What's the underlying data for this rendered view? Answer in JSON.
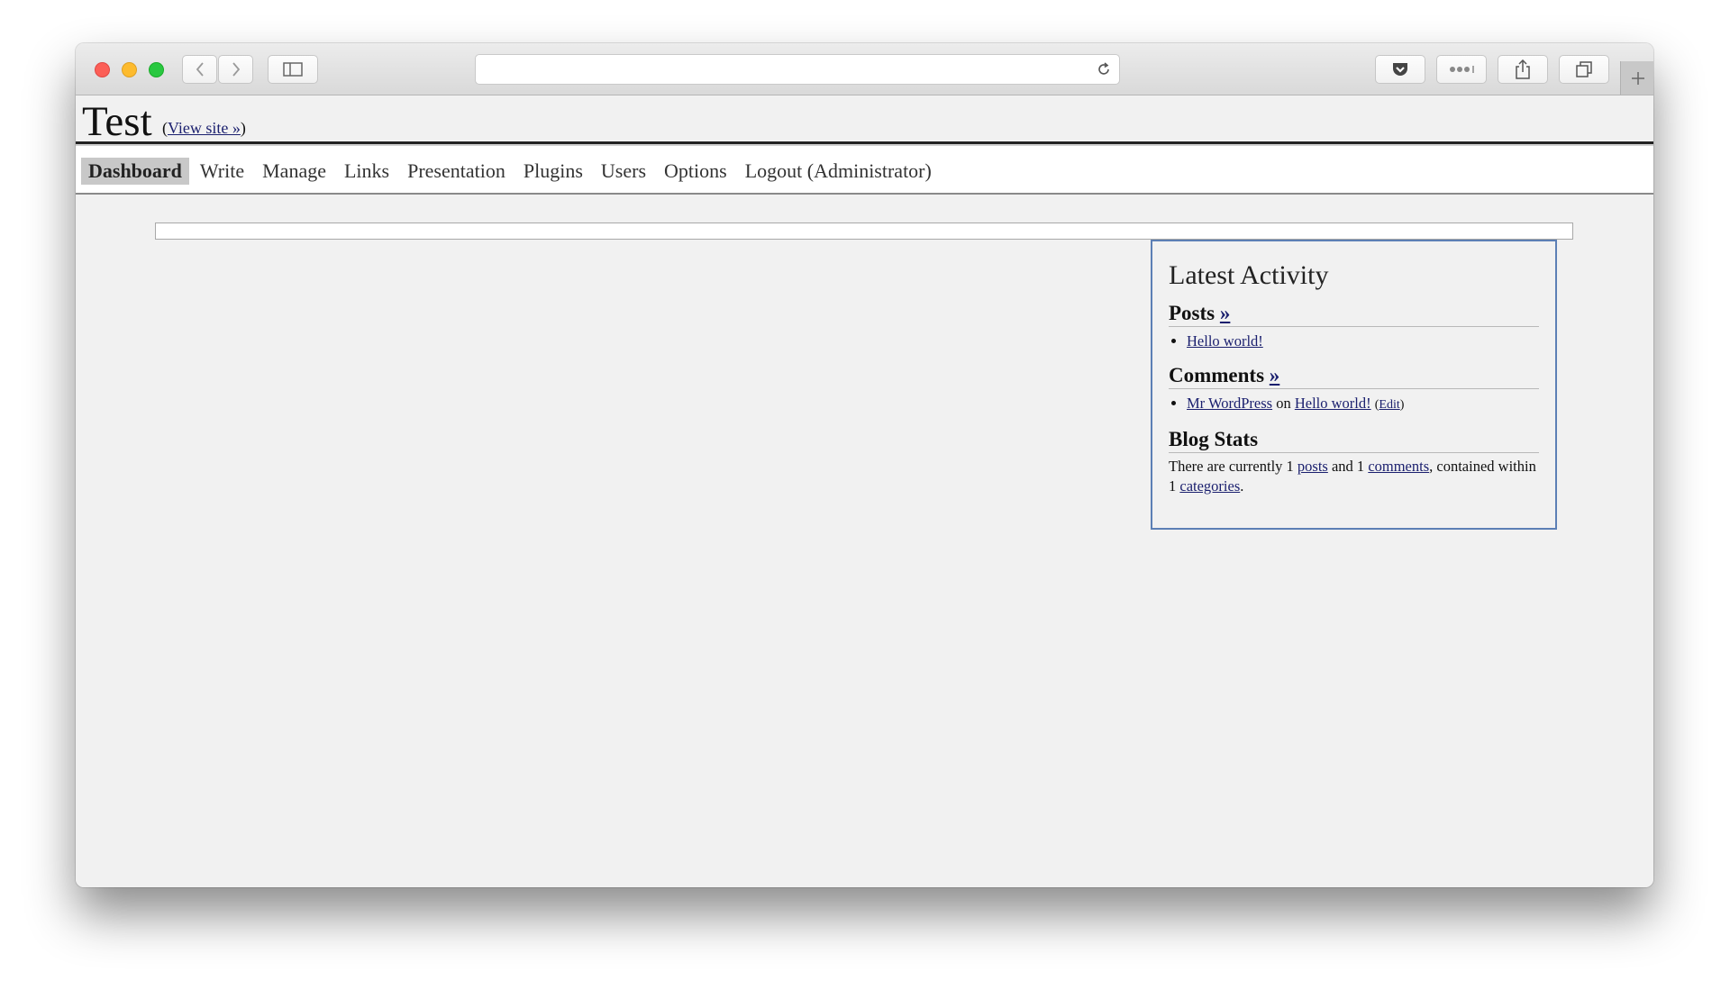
{
  "browser": {
    "address_value": "",
    "icons": [
      "back-icon",
      "forward-icon",
      "sidebar-icon",
      "reload-icon",
      "pocket-icon",
      "extensions-icon",
      "share-icon",
      "tabs-icon",
      "new-tab-icon"
    ]
  },
  "site": {
    "title": "Test",
    "view_site_open": "(",
    "view_site_link": "View site »",
    "view_site_close": ")"
  },
  "menu": {
    "items": [
      {
        "label": "Dashboard",
        "active": true
      },
      {
        "label": "Write"
      },
      {
        "label": "Manage"
      },
      {
        "label": "Links"
      },
      {
        "label": "Presentation"
      },
      {
        "label": "Plugins"
      },
      {
        "label": "Users"
      },
      {
        "label": "Options"
      },
      {
        "label": "Logout (Administrator)"
      }
    ]
  },
  "activity": {
    "title": "Latest Activity",
    "posts": {
      "heading": "Posts",
      "more": "»",
      "items": [
        "Hello world!"
      ]
    },
    "comments": {
      "heading": "Comments",
      "more": "»",
      "author": "Mr WordPress",
      "on": "on",
      "post": "Hello world!",
      "edit_open": "(",
      "edit": "Edit",
      "edit_close": ")"
    },
    "stats": {
      "heading": "Blog Stats",
      "t1": "There are currently 1 ",
      "posts_link": "posts",
      "t2": " and 1 ",
      "comments_link": "comments",
      "t3": ", contained within 1 ",
      "categories_link": "categories",
      "t4": "."
    }
  },
  "colors": {
    "panel_border": "#5c7fb5",
    "link": "#1a1f6e",
    "active_tab": "#c8c8c8"
  }
}
